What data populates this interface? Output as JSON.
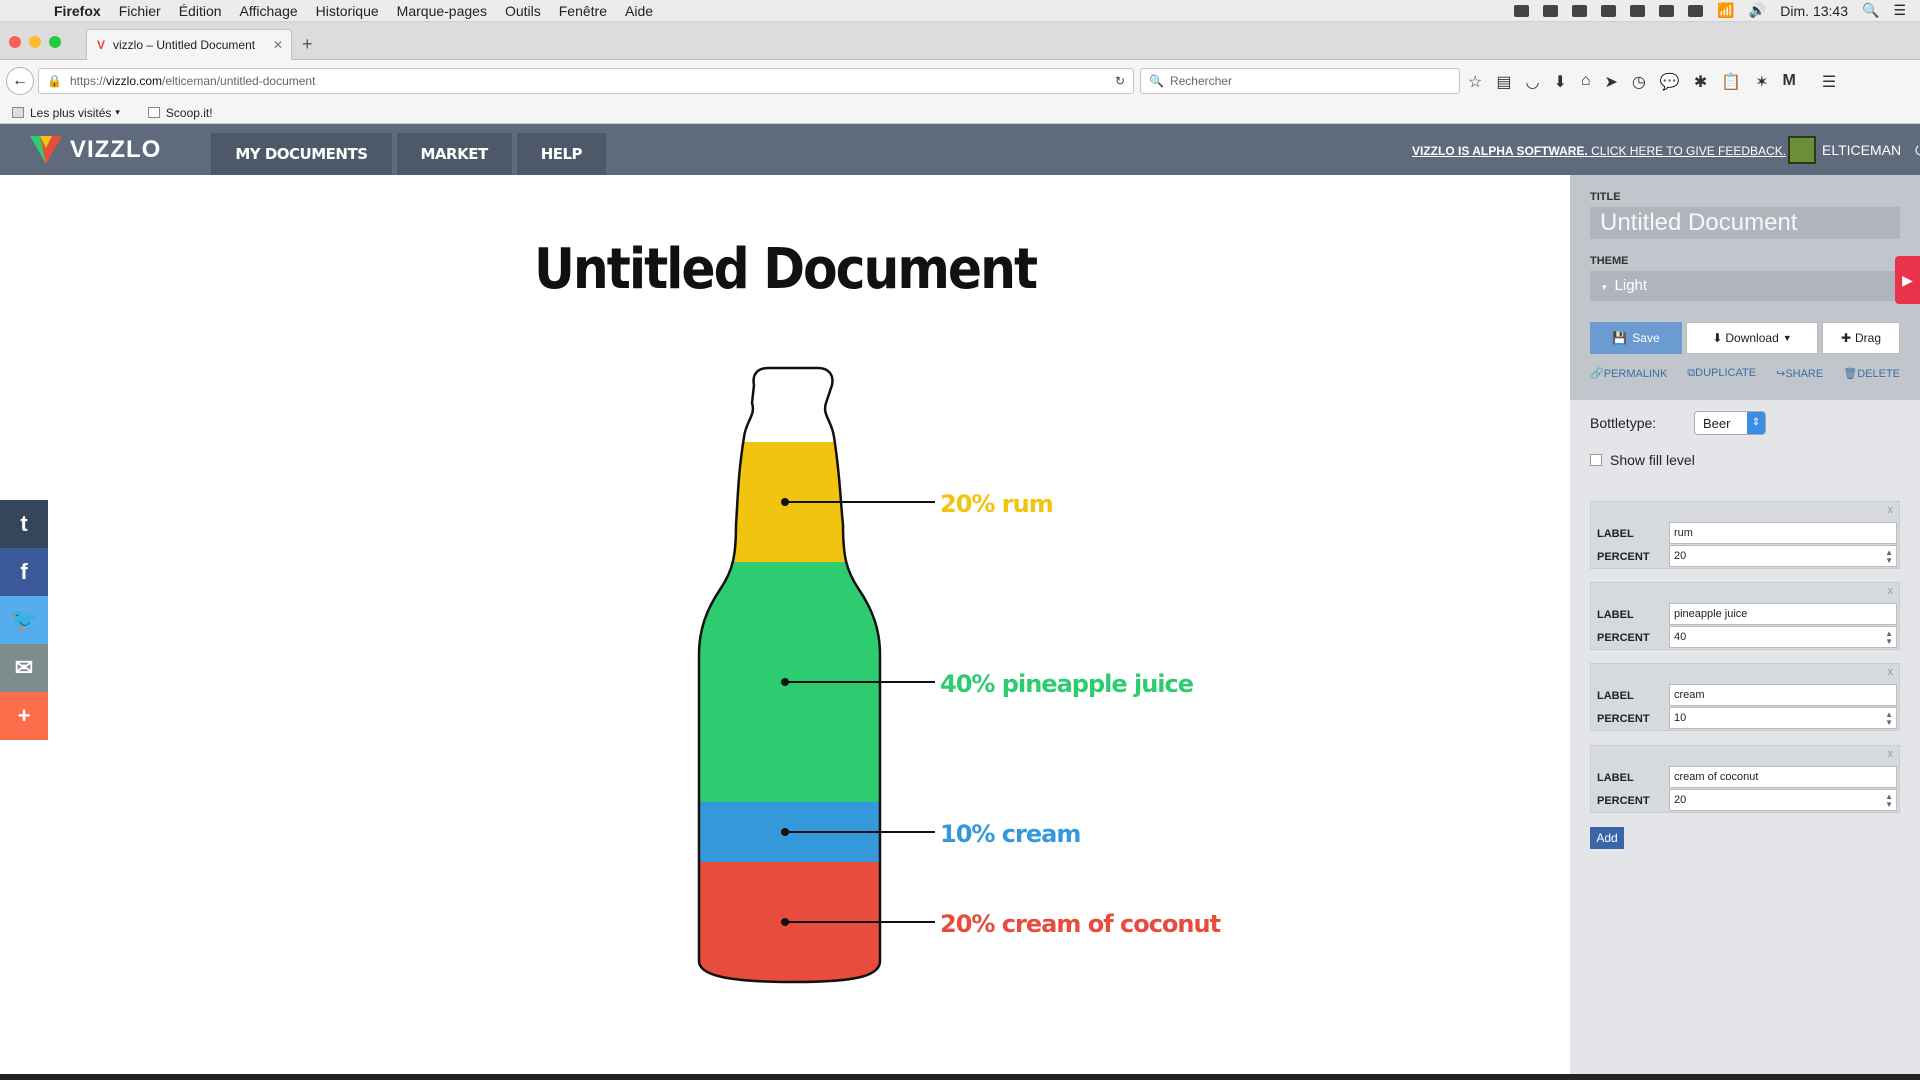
{
  "macmenu": {
    "app": "Firefox",
    "items": [
      "Fichier",
      "Édition",
      "Affichage",
      "Historique",
      "Marque-pages",
      "Outils",
      "Fenêtre",
      "Aide"
    ],
    "clock": "Dim. 13:43"
  },
  "browser": {
    "tab_title": "vizzlo – Untitled Document",
    "url_prefix": "https://",
    "url_host": "vizzlo.com",
    "url_path": "/elticeman/untitled-document",
    "search_placeholder": "Rechercher",
    "bookmarks": [
      "Les plus visités",
      "Scoop.it!"
    ]
  },
  "app": {
    "logo": "VIZZLO",
    "nav": [
      "MY DOCUMENTS",
      "MARKET",
      "HELP"
    ],
    "alpha_bold": "VIZZLO IS ALPHA SOFTWARE.",
    "alpha_rest": " CLICK HERE TO GIVE FEEDBACK.",
    "username": "ELTICEMAN"
  },
  "document": {
    "title": "Untitled Document"
  },
  "chart_data": {
    "type": "bar",
    "categories": [
      "rum",
      "pineapple juice",
      "cream",
      "cream of coconut"
    ],
    "values": [
      20,
      40,
      10,
      20
    ],
    "labels": [
      "20% rum",
      "40% pineapple juice",
      "10% cream",
      "20% cream of coconut"
    ],
    "colors": [
      "#f1c40f",
      "#2ecc71",
      "#3498db",
      "#e74c3c"
    ]
  },
  "social": [
    {
      "name": "tumblr-icon",
      "glyph": "t",
      "color": "#35465c"
    },
    {
      "name": "facebook-icon",
      "glyph": "f",
      "color": "#3b5998"
    },
    {
      "name": "twitter-icon",
      "glyph": "🐦",
      "color": "#55acee"
    },
    {
      "name": "email-icon",
      "glyph": "✉",
      "color": "#7f8c8d"
    },
    {
      "name": "share-more-icon",
      "glyph": "+",
      "color": "#fc6d4c"
    }
  ],
  "panel": {
    "title_label": "TITLE",
    "title_value": "Untitled Document",
    "theme_label": "THEME",
    "theme_value": "Light",
    "save": "Save",
    "download": "Download",
    "drag": "Drag",
    "actions": [
      "PERMALINK",
      "DUPLICATE",
      "SHARE",
      "DELETE"
    ],
    "bottletype_label": "Bottletype:",
    "bottletype_value": "Beer",
    "fill_label": "Show fill level",
    "label_word": "LABEL",
    "percent_word": "PERCENT",
    "items": [
      {
        "label": "rum",
        "percent": "20"
      },
      {
        "label": "pineapple juice",
        "percent": "40"
      },
      {
        "label": "cream",
        "percent": "10"
      },
      {
        "label": "cream of coconut",
        "percent": "20"
      }
    ],
    "add": "Add"
  }
}
